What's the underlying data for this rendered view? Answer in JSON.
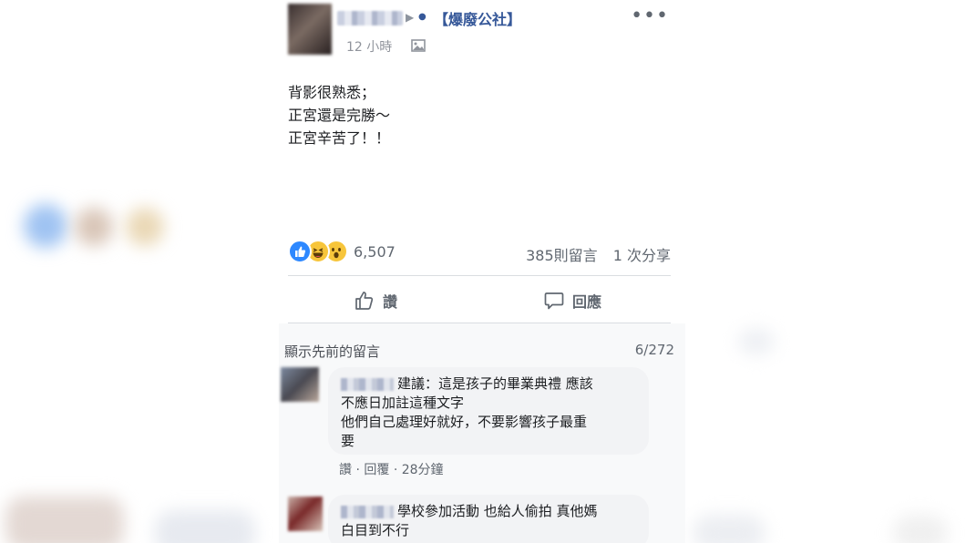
{
  "post": {
    "group_name": "【爆廢公社】",
    "timestamp": "12 小時",
    "lines": [
      "背影很熟悉；",
      "正宮還是完勝～",
      "正宮辛苦了！！"
    ],
    "more_label": "•••"
  },
  "reactions": {
    "icons": [
      "like-icon",
      "haha-icon",
      "wow-icon"
    ],
    "count": "6,507",
    "comments": "385則留言",
    "shares": "1 次分享"
  },
  "actions": {
    "like_label": "讚",
    "comment_label": "回應"
  },
  "comments_section": {
    "view_previous": "顯示先前的留言",
    "count": "6/272",
    "comments": [
      {
        "lines": [
          "建議：這是孩子的畢業典禮 應該",
          "不應日加註這種文字",
          "他們自己處理好就好，不要影響孩子最重",
          "要"
        ],
        "like_label": "讚",
        "reply_label": "回覆",
        "time": "28分鐘"
      },
      {
        "lines": [
          "學校參加活動 也給人偷拍 真他媽",
          "白目到不行"
        ]
      }
    ]
  },
  "colors": {
    "link": "#365899",
    "secondary_text": "#606770",
    "divider": "#dadde1",
    "bubble": "#f2f3f5",
    "like_blue": "#2d88ff",
    "emoji_yellow": "#f7c53b"
  }
}
